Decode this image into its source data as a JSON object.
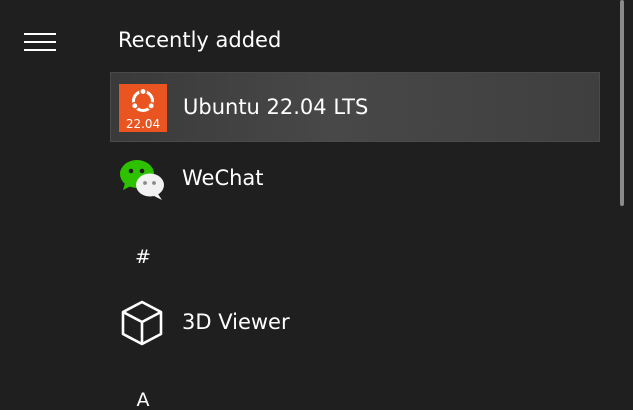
{
  "start_menu": {
    "menu_icon": "hamburger-menu-icon",
    "section_title": "Recently added",
    "apps": [
      {
        "label": "Ubuntu 22.04 LTS",
        "icon": "ubuntu-icon",
        "icon_text": "22.04",
        "selected": true,
        "icon_color": "#e95420"
      },
      {
        "label": "WeChat",
        "icon": "wechat-icon",
        "selected": false,
        "icon_color": "#2dc100"
      },
      {
        "label": "3D Viewer",
        "icon": "cube-icon",
        "selected": false
      }
    ],
    "group_letters": [
      "#",
      "A"
    ]
  }
}
